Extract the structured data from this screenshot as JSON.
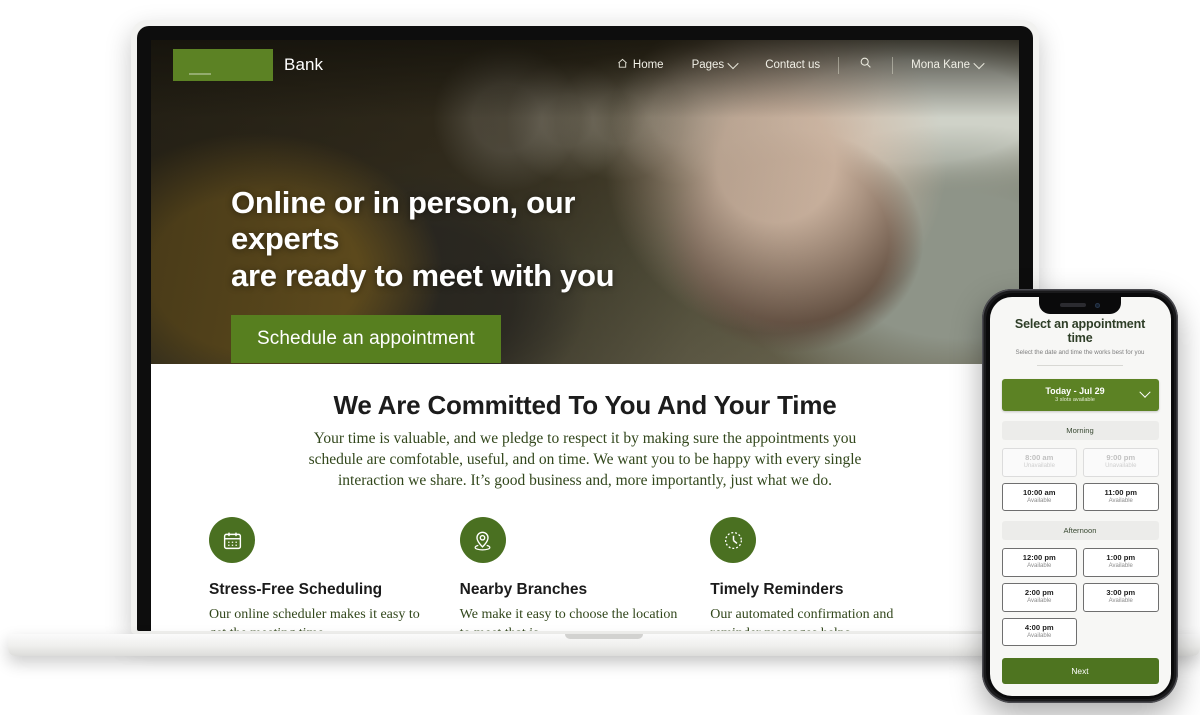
{
  "laptop": {
    "nav": {
      "brand": "Bank",
      "logo_icon": "brand-logo-block",
      "links": [
        {
          "label": "Home",
          "icon": "home-icon",
          "has_chevron": false
        },
        {
          "label": "Pages",
          "icon": "",
          "has_chevron": true
        },
        {
          "label": "Contact us",
          "icon": "",
          "has_chevron": false
        }
      ],
      "search_icon": "search-icon",
      "account": {
        "label": "Mona Kane",
        "has_chevron": true
      }
    },
    "hero": {
      "heading_line1": "Online or in person, our experts",
      "heading_line2": "are ready to meet with you",
      "cta_label": "Schedule an appointment"
    },
    "committed": {
      "heading": "We Are Committed To You And Your Time",
      "paragraph": "Your time is valuable, and we pledge to respect it by making sure the appointments you schedule are comfotable, useful, and on time. We want you to be happy with every single interaction we share. It’s good business and, more importantly, just what we do."
    },
    "cards": [
      {
        "icon": "calendar-icon",
        "title": "Stress-Free Scheduling",
        "text": "Our online scheduler makes it easy to get the meeting time"
      },
      {
        "icon": "location-pin-icon",
        "title": "Nearby Branches",
        "text": "We make it easy to choose the location to meet that is"
      },
      {
        "icon": "clock-icon",
        "title": "Timely Reminders",
        "text": "Our automated confirmation and reminder messages helps"
      }
    ]
  },
  "phone": {
    "title": "Select an appointment time",
    "subtitle": "Select the date and time the works best for you",
    "date_selector": {
      "label": "Today - Jul 29",
      "sublabel": "3 slots available",
      "chevron_icon": "chevron-down-icon"
    },
    "groups": [
      {
        "heading": "Morning",
        "slots": [
          {
            "time": "8:00 am",
            "status": "Unavailable",
            "available": false
          },
          {
            "time": "9:00 pm",
            "status": "Unavailable",
            "available": false
          },
          {
            "time": "10:00 am",
            "status": "Available",
            "available": true
          },
          {
            "time": "11:00 pm",
            "status": "Available",
            "available": true
          }
        ]
      },
      {
        "heading": "Afternoon",
        "slots": [
          {
            "time": "12:00 pm",
            "status": "Available",
            "available": true
          },
          {
            "time": "1:00 pm",
            "status": "Available",
            "available": true
          },
          {
            "time": "2:00 pm",
            "status": "Available",
            "available": true
          },
          {
            "time": "3:00 pm",
            "status": "Available",
            "available": true
          },
          {
            "time": "4:00 pm",
            "status": "Available",
            "available": true
          }
        ]
      }
    ],
    "next_label": "Next"
  },
  "colors": {
    "brand_green": "#5c8224",
    "cta_green": "#577f1f",
    "icon_green": "#4a7021",
    "next_green": "#4e7420",
    "body_text_green": "#32471c"
  }
}
